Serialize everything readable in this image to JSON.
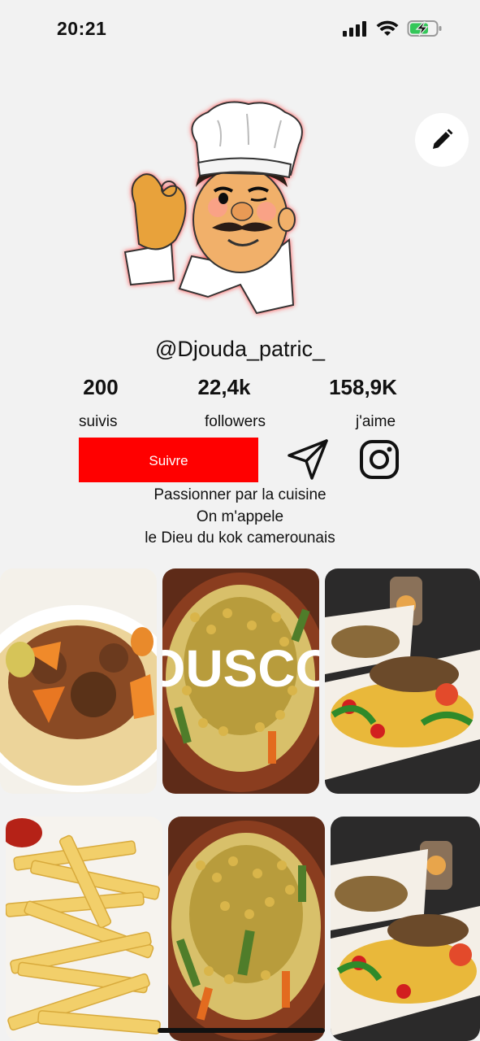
{
  "status_bar": {
    "time": "20:21"
  },
  "profile": {
    "username": "@Djouda_patric_",
    "stats": [
      {
        "value": "200",
        "label": "suivis"
      },
      {
        "value": "22,4k",
        "label": "followers"
      },
      {
        "value": "158,9K",
        "label": "j'aime"
      }
    ],
    "follow_label": "Suivre",
    "bio": [
      "Passionner par la cuisine",
      "On m'appele",
      "le Dieu du kok camerounais"
    ]
  },
  "icons": {
    "edit": "pencil-icon",
    "share": "send-icon",
    "instagram": "instagram-icon"
  },
  "grid": {
    "overlay_text": "OUSCO",
    "tiles": [
      "couscous-meat",
      "couscous-tagine",
      "plated-dish",
      "french-fries",
      "couscous-tagine",
      "plated-dish"
    ]
  },
  "colors": {
    "follow_button": "#ff0000",
    "background": "#f2f2f2"
  }
}
